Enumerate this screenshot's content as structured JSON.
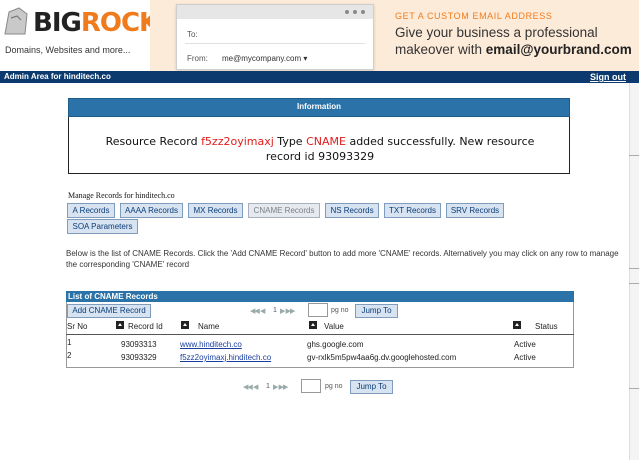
{
  "header": {
    "logo_big": "BIG",
    "logo_rock": "ROCK",
    "logo_tagline": "Domains, Websites and more...",
    "mail_to_label": "To:",
    "mail_from_label": "From:",
    "mail_from_value": "me@mycompany.com ▾",
    "promo_head": "GET A CUSTOM EMAIL ADDRESS",
    "promo_line1": "Give your business a professional",
    "promo_line2_prefix": "makeover with ",
    "promo_line2_bold": "email@yourbrand.com"
  },
  "admin_bar": {
    "title": "Admin Area for hinditech.co",
    "sign_out": "Sign out"
  },
  "info": {
    "heading": "Information",
    "msg_a": "Resource Record ",
    "msg_record": "f5zz2oyimaxj",
    "msg_b": " Type ",
    "msg_type": "CNAME",
    "msg_c": " added successfully. New resource record id 93093329"
  },
  "manage": {
    "label": "Manage Records for hinditech.co",
    "tabs": [
      {
        "label": "A Records"
      },
      {
        "label": "AAAA Records"
      },
      {
        "label": "MX Records"
      },
      {
        "label": "CNAME Records"
      },
      {
        "label": "NS Records"
      },
      {
        "label": "TXT Records"
      },
      {
        "label": "SRV Records"
      },
      {
        "label": "SOA Parameters"
      }
    ]
  },
  "description": "Below is the list of CNAME Records. Click the 'Add CNAME Record' button to add more 'CNAME' records. Alternatively you may click on any row to manage the corresponding 'CNAME' record",
  "list": {
    "heading": "List of CNAME Records",
    "add_button": "Add CNAME Record",
    "pager": {
      "prev": "◀◀ ◀",
      "page": "1",
      "next": "▶ ▶▶",
      "pg_no": "pg no",
      "jump": "Jump To"
    },
    "columns": [
      "Sr No",
      "Record Id",
      "Name",
      "Value",
      "Status"
    ],
    "rows": [
      {
        "sr": "1",
        "id": "93093313",
        "name": "www.hinditech.co",
        "value": "ghs.google.com",
        "status": "Active"
      },
      {
        "sr": "2",
        "id": "93093329",
        "name": "f5zz2oyimaxj.hinditech.co",
        "value": "gv-rxlk5m5pw4aa6g.dv.googlehosted.com",
        "status": "Active"
      }
    ]
  },
  "colors": {
    "brand_orange": "#f07b1c",
    "admin_bar": "#0c3a6e",
    "section_blue": "#2a72a8",
    "alert_red": "#e01b1b"
  }
}
